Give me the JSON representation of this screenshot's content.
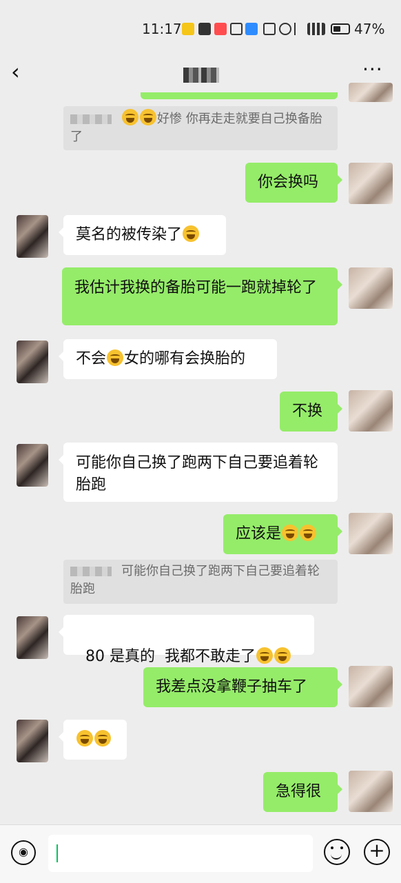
{
  "status_bar": {
    "time": "11:17",
    "battery": "47%"
  },
  "header": {
    "back_icon": "‹",
    "more_icon": "···"
  },
  "messages": [
    {
      "type": "quote",
      "text": "好惨 你再走走就要自己换备胎了"
    },
    {
      "type": "out",
      "text": "你会换吗"
    },
    {
      "type": "in",
      "text": "莫名的被传染了"
    },
    {
      "type": "out",
      "text": "我估计我换的备胎可能一跑就掉轮了"
    },
    {
      "type": "in",
      "text_a": "不会",
      "text_b": "女的哪有会换胎的"
    },
    {
      "type": "out",
      "text": "不换"
    },
    {
      "type": "in",
      "text": "可能你自己换了跑两下自己要追着轮胎跑"
    },
    {
      "type": "out",
      "text": "应该是"
    },
    {
      "type": "quote",
      "text": "可能你自己换了跑两下自己要追着轮胎跑"
    },
    {
      "type": "in",
      "text": "80 是真的  我都不敢走了"
    },
    {
      "type": "out",
      "text": "我差点没拿鞭子抽车了"
    },
    {
      "type": "in",
      "text": ""
    },
    {
      "type": "out",
      "text": "急得很"
    }
  ],
  "input_bar": {
    "voice_icon": "◉)",
    "plus_icon": "+"
  }
}
